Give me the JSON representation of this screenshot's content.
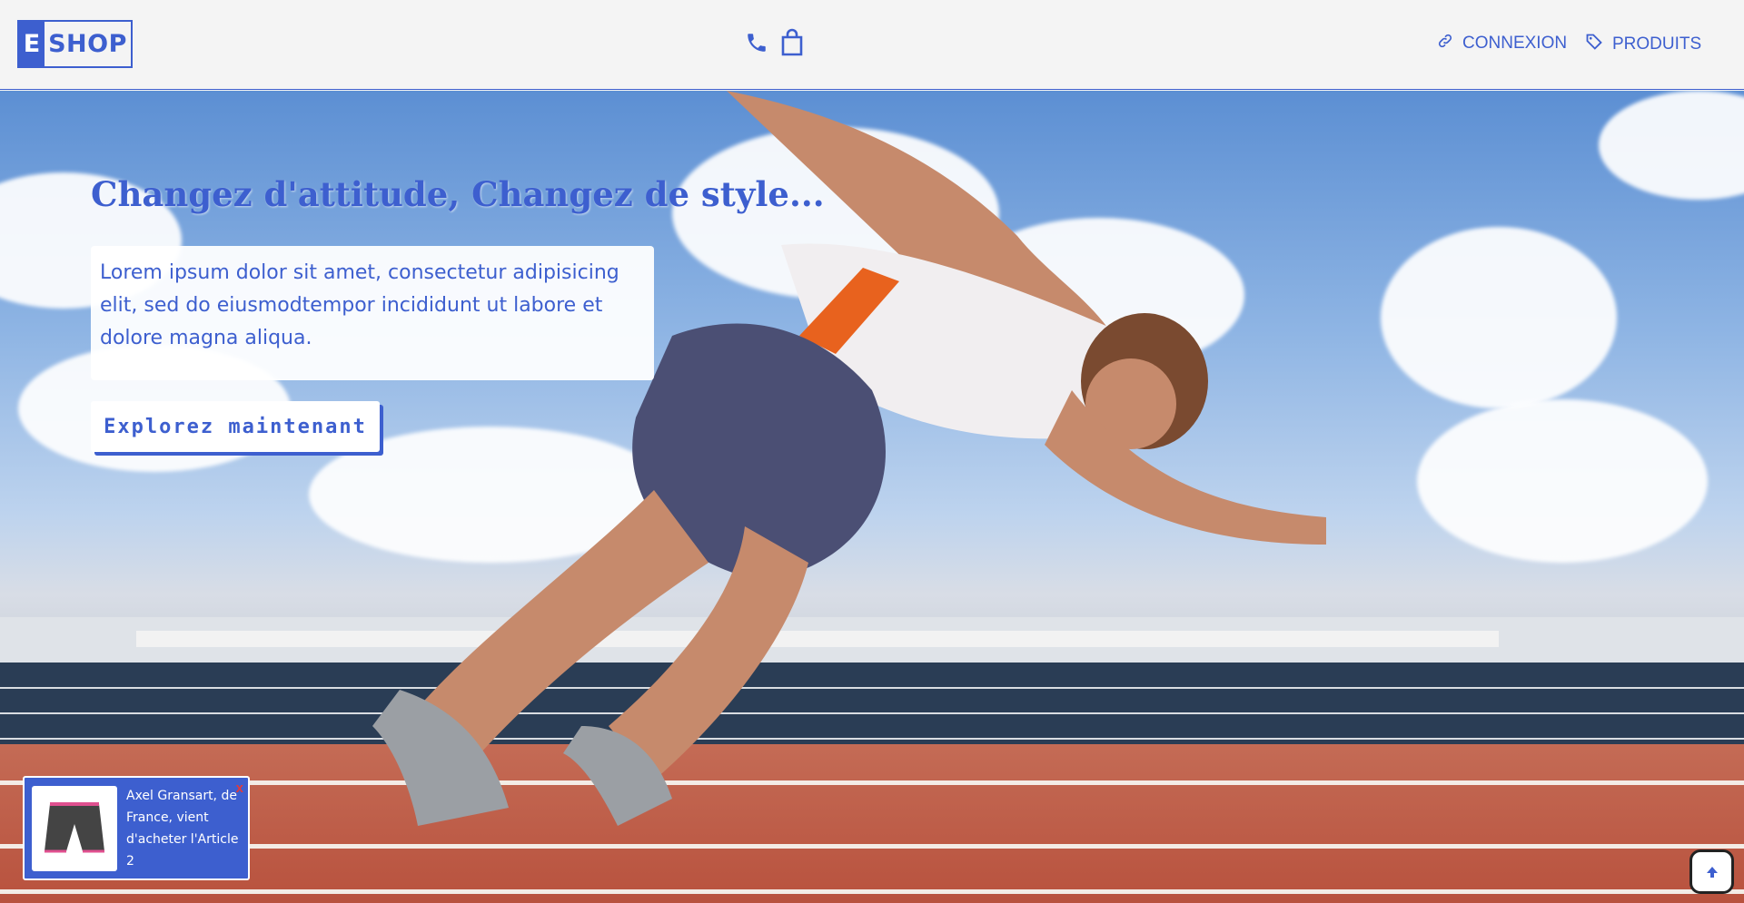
{
  "header": {
    "logo": {
      "prefix": "E",
      "rest": "SHOP"
    },
    "icons": {
      "phone": "phone-icon",
      "bag": "shopping-bag-icon"
    },
    "nav": [
      {
        "label": "CONNEXION",
        "icon": "link-icon"
      },
      {
        "label": "PRODUITS",
        "icon": "tag-icon"
      }
    ]
  },
  "hero": {
    "title": "Changez d'attitude, Changez de style...",
    "text": "Lorem ipsum dolor sit amet, consectetur adipisicing elit, sed do eiusmodtempor incididunt ut labore et dolore magna aliqua.",
    "button_label": "Explorez maintenant"
  },
  "notification": {
    "text": "Axel Gransart, de France, vient d'acheter l'Article 2",
    "close_label": "x"
  },
  "colors": {
    "accent": "#3d5fcf",
    "close": "#e23a3a"
  }
}
